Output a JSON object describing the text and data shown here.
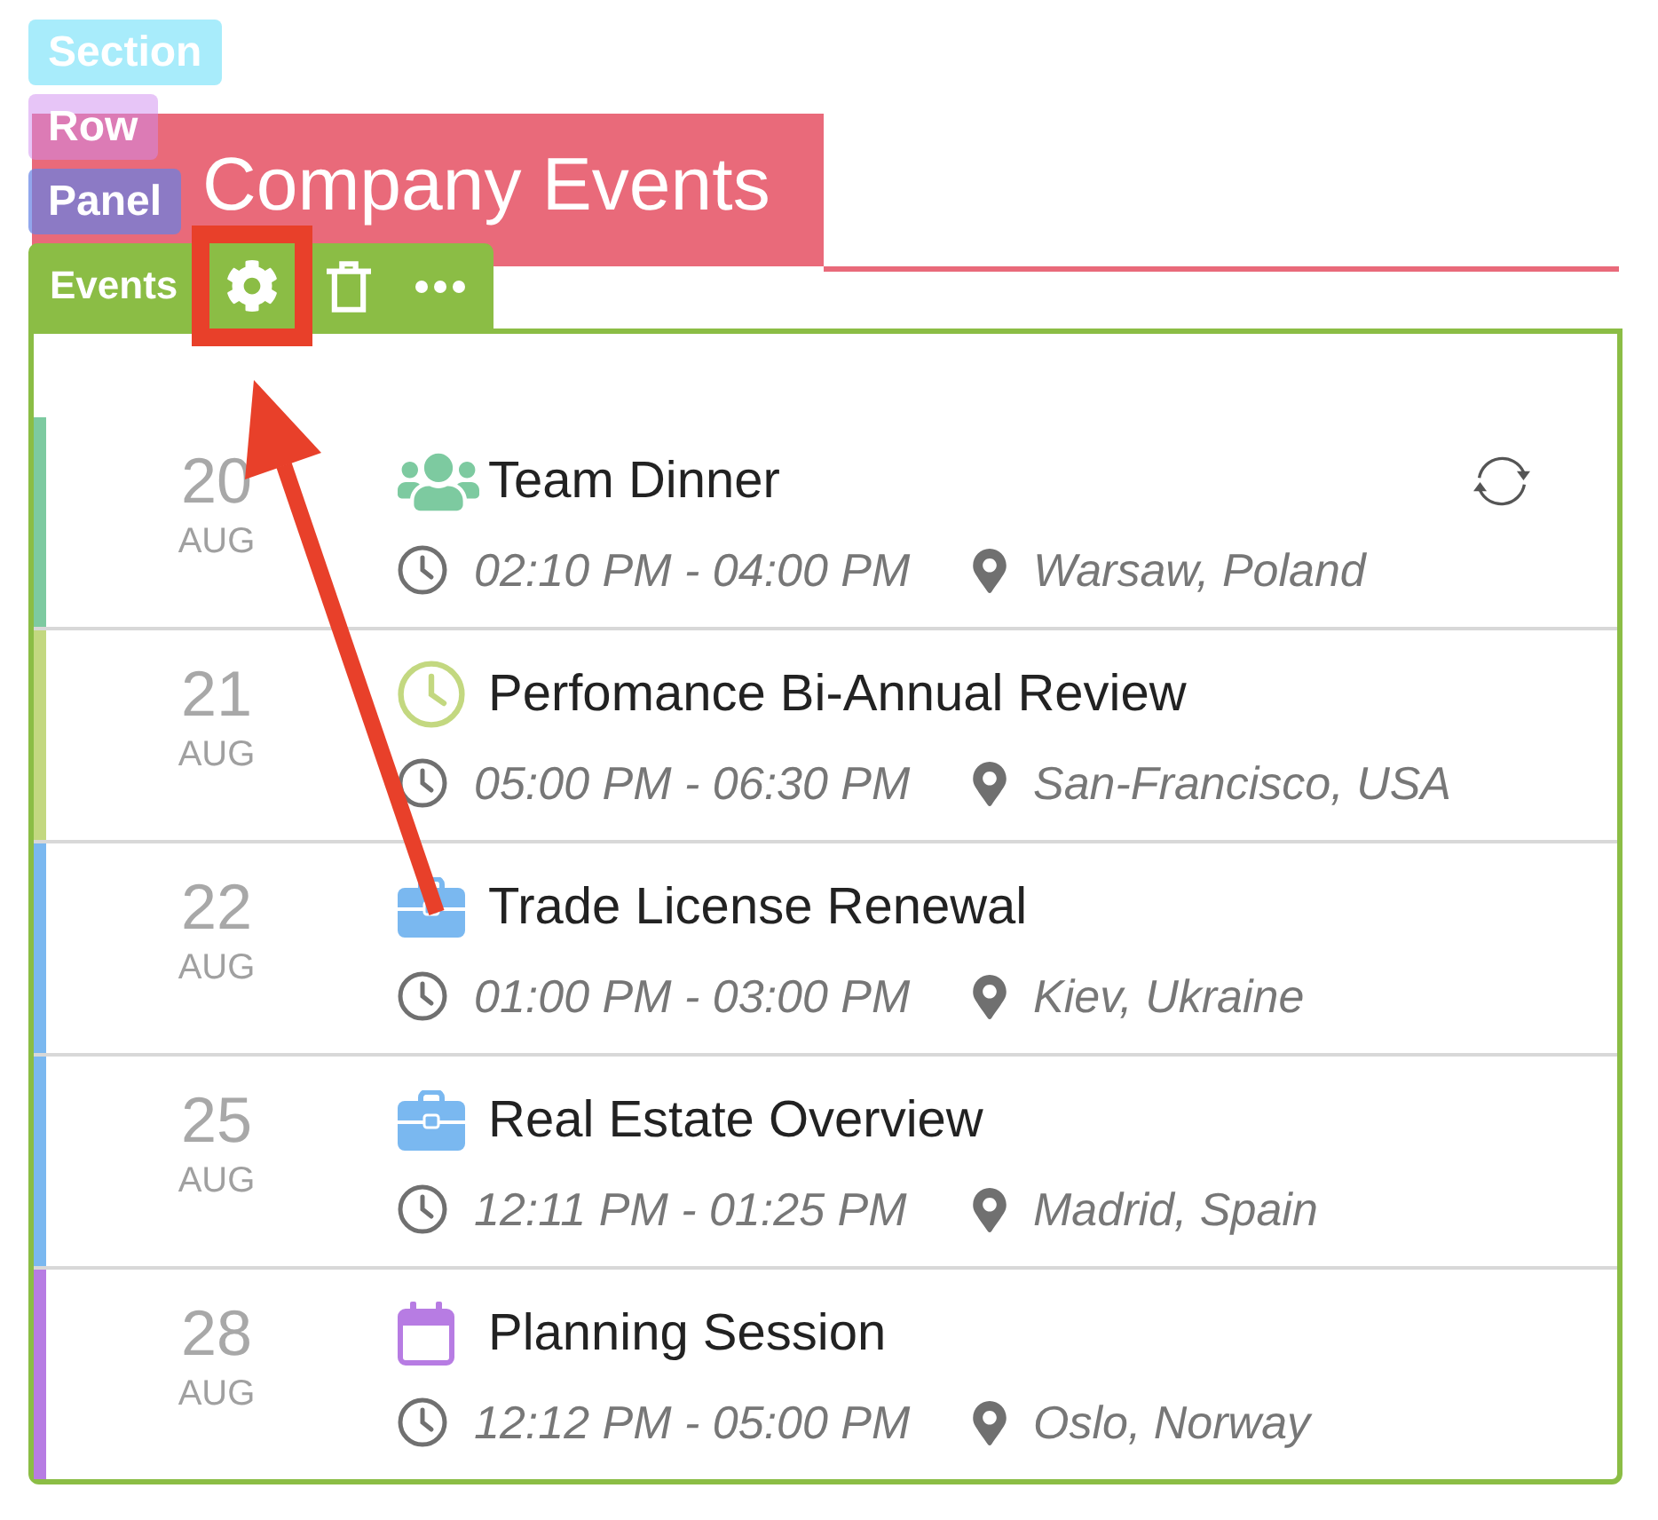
{
  "editor_badges": [
    {
      "kind": "section",
      "label": "Section"
    },
    {
      "kind": "row",
      "label": "Row"
    },
    {
      "kind": "panel",
      "label": "Panel"
    }
  ],
  "page_title": "Company Events",
  "panel": {
    "tab_title": "Events",
    "actions": [
      {
        "kind": "settings",
        "highlighted": true
      },
      {
        "kind": "delete",
        "highlighted": false
      },
      {
        "kind": "more",
        "highlighted": false
      }
    ]
  },
  "events": [
    {
      "day": "20",
      "month": "AUG",
      "color": "#7dcaa0",
      "kind": "team",
      "title": "Team Dinner",
      "time": "02:10 PM - 04:00 PM",
      "location": "Warsaw, Poland",
      "recurring": true
    },
    {
      "day": "21",
      "month": "AUG",
      "color": "#c3d880",
      "kind": "clock",
      "title": "Perfomance Bi-Annual Review",
      "time": "05:00 PM - 06:30 PM",
      "location": "San-Francisco, USA",
      "recurring": false
    },
    {
      "day": "22",
      "month": "AUG",
      "color": "#7ab8f0",
      "kind": "briefcase",
      "title": "Trade License Renewal",
      "time": "01:00 PM - 03:00 PM",
      "location": "Kiev, Ukraine",
      "recurring": false
    },
    {
      "day": "25",
      "month": "AUG",
      "color": "#7ab8f0",
      "kind": "briefcase",
      "title": "Real Estate Overview",
      "time": "12:11 PM - 01:25 PM",
      "location": "Madrid, Spain",
      "recurring": false
    },
    {
      "day": "28",
      "month": "AUG",
      "color": "#b77ce3",
      "kind": "calendar",
      "title": "Planning Session",
      "time": "12:12 PM - 05:00 PM",
      "location": "Oslo, Norway",
      "recurring": false
    }
  ]
}
